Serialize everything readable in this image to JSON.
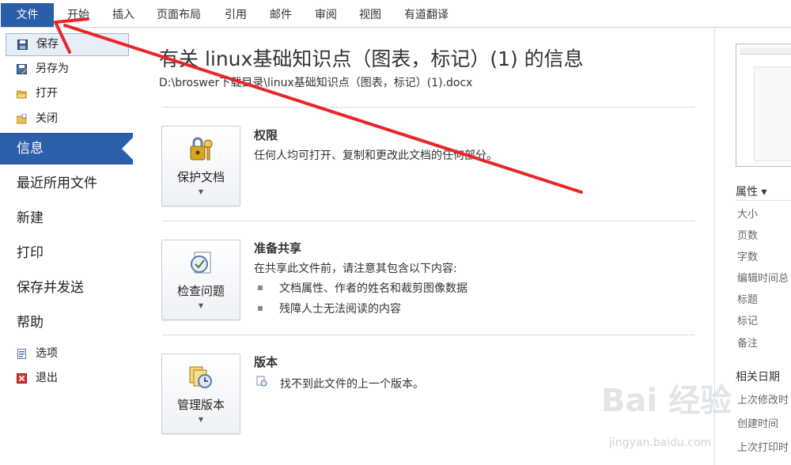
{
  "ribbon": {
    "file_tab": "文件",
    "tabs": [
      "开始",
      "插入",
      "页面布局",
      "引用",
      "邮件",
      "审阅",
      "视图",
      "有道翻译"
    ]
  },
  "nav": {
    "commands_top": [
      "保存",
      "另存为",
      "打开",
      "关闭"
    ],
    "sections": [
      "信息",
      "最近所用文件",
      "新建",
      "打印",
      "保存并发送",
      "帮助"
    ],
    "commands_bottom": [
      "选项",
      "退出"
    ]
  },
  "info": {
    "title": "有关 linux基础知识点（图表，标记）(1) 的信息",
    "path": "D:\\broswer下载目录\\linux基础知识点（图表，标记）(1).docx",
    "permissions": {
      "button": "保护文档",
      "heading": "权限",
      "text": "任何人均可打开、复制和更改此文档的任何部分。"
    },
    "prepare": {
      "button": "检查问题",
      "heading": "准备共享",
      "text": "在共享此文件前，请注意其包含以下内容:",
      "bullets": [
        "文档属性、作者的姓名和裁剪图像数据",
        "残障人士无法阅读的内容"
      ]
    },
    "versions": {
      "button": "管理版本",
      "heading": "版本",
      "text": "找不到此文件的上一个版本。"
    }
  },
  "properties": {
    "heading": "属性 ▾",
    "items": [
      "大小",
      "页数",
      "字数",
      "编辑时间总",
      "标题",
      "标记",
      "备注"
    ],
    "dates_heading": "相关日期",
    "dates": [
      "上次修改时",
      "创建时间",
      "上次打印时"
    ]
  },
  "watermark": {
    "logo": "Bai 经验",
    "url": "jingyan.baidu.com"
  },
  "colors": {
    "accent": "#2b5fa9",
    "arrow": "#e8252a"
  }
}
